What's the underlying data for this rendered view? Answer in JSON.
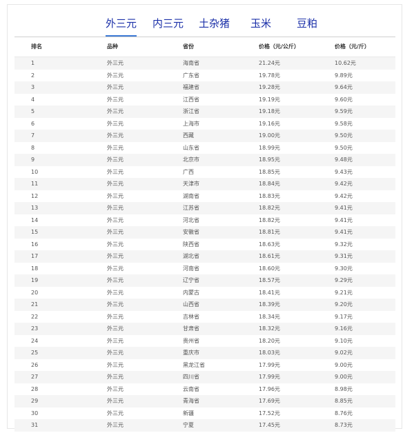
{
  "tabs": [
    "外三元",
    "内三元",
    "土杂猪",
    "玉米",
    "豆粕"
  ],
  "table": {
    "headers": [
      "排名",
      "品种",
      "省份",
      "价格（元/公斤）",
      "价格（元/斤）"
    ],
    "rows": [
      [
        "1",
        "外三元",
        "海南省",
        "21.24元",
        "10.62元"
      ],
      [
        "2",
        "外三元",
        "广东省",
        "19.78元",
        "9.89元"
      ],
      [
        "3",
        "外三元",
        "福建省",
        "19.28元",
        "9.64元"
      ],
      [
        "4",
        "外三元",
        "江西省",
        "19.19元",
        "9.60元"
      ],
      [
        "5",
        "外三元",
        "浙江省",
        "19.18元",
        "9.59元"
      ],
      [
        "6",
        "外三元",
        "上海市",
        "19.16元",
        "9.58元"
      ],
      [
        "7",
        "外三元",
        "西藏",
        "19.00元",
        "9.50元"
      ],
      [
        "8",
        "外三元",
        "山东省",
        "18.99元",
        "9.50元"
      ],
      [
        "9",
        "外三元",
        "北京市",
        "18.95元",
        "9.48元"
      ],
      [
        "10",
        "外三元",
        "广西",
        "18.85元",
        "9.43元"
      ],
      [
        "11",
        "外三元",
        "天津市",
        "18.84元",
        "9.42元"
      ],
      [
        "12",
        "外三元",
        "湖南省",
        "18.83元",
        "9.42元"
      ],
      [
        "13",
        "外三元",
        "江苏省",
        "18.82元",
        "9.41元"
      ],
      [
        "14",
        "外三元",
        "河北省",
        "18.82元",
        "9.41元"
      ],
      [
        "15",
        "外三元",
        "安徽省",
        "18.81元",
        "9.41元"
      ],
      [
        "16",
        "外三元",
        "陕西省",
        "18.63元",
        "9.32元"
      ],
      [
        "17",
        "外三元",
        "湖北省",
        "18.61元",
        "9.31元"
      ],
      [
        "18",
        "外三元",
        "河南省",
        "18.60元",
        "9.30元"
      ],
      [
        "19",
        "外三元",
        "辽宁省",
        "18.57元",
        "9.29元"
      ],
      [
        "20",
        "外三元",
        "内蒙古",
        "18.41元",
        "9.21元"
      ],
      [
        "21",
        "外三元",
        "山西省",
        "18.39元",
        "9.20元"
      ],
      [
        "22",
        "外三元",
        "吉林省",
        "18.34元",
        "9.17元"
      ],
      [
        "23",
        "外三元",
        "甘肃省",
        "18.32元",
        "9.16元"
      ],
      [
        "24",
        "外三元",
        "贵州省",
        "18.20元",
        "9.10元"
      ],
      [
        "25",
        "外三元",
        "重庆市",
        "18.03元",
        "9.02元"
      ],
      [
        "26",
        "外三元",
        "黑龙江省",
        "17.99元",
        "9.00元"
      ],
      [
        "27",
        "外三元",
        "四川省",
        "17.99元",
        "9.00元"
      ],
      [
        "28",
        "外三元",
        "云南省",
        "17.96元",
        "8.98元"
      ],
      [
        "29",
        "外三元",
        "青海省",
        "17.69元",
        "8.85元"
      ],
      [
        "30",
        "外三元",
        "新疆",
        "17.52元",
        "8.76元"
      ],
      [
        "31",
        "外三元",
        "宁夏",
        "17.45元",
        "8.73元"
      ]
    ]
  }
}
